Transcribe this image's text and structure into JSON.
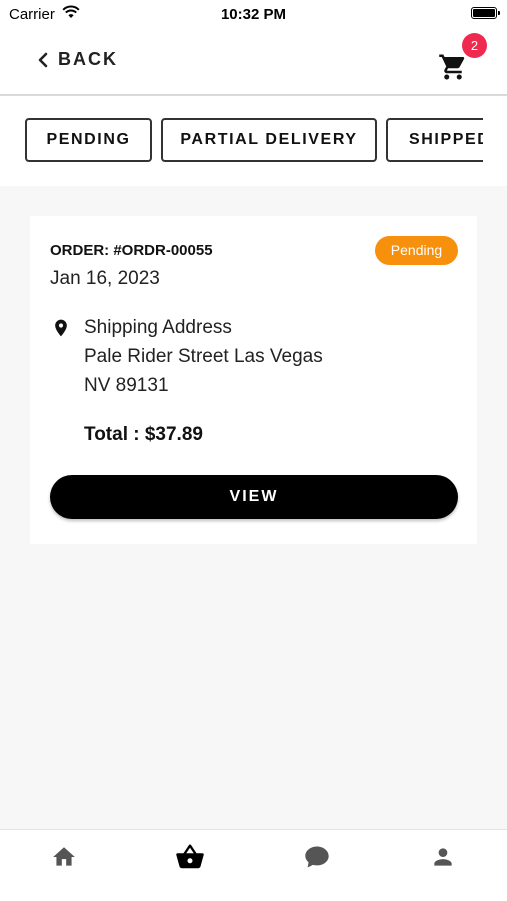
{
  "status_bar": {
    "carrier": "Carrier",
    "time": "10:32 PM"
  },
  "header": {
    "back_label": "BACK",
    "cart_count": "2"
  },
  "tabs": [
    {
      "label": "PENDING",
      "active": true
    },
    {
      "label": "PARTIAL DELIVERY",
      "active": false
    },
    {
      "label": "SHIPPED",
      "active": false
    }
  ],
  "order": {
    "id": "ORDER: #ORDR-00055",
    "date": "Jan 16, 2023",
    "status": "Pending",
    "address_label": "Shipping Address",
    "address_line1": "Pale Rider Street Las Vegas",
    "address_line2": "NV 89131",
    "total": "Total : $37.89",
    "view_label": "VIEW"
  },
  "bottom_nav": [
    {
      "icon": "home-icon"
    },
    {
      "icon": "basket-icon",
      "active": true
    },
    {
      "icon": "chat-icon"
    },
    {
      "icon": "profile-icon"
    }
  ],
  "colors": {
    "badge": "#f0294f",
    "status": "#f7900c",
    "button": "#000000"
  }
}
